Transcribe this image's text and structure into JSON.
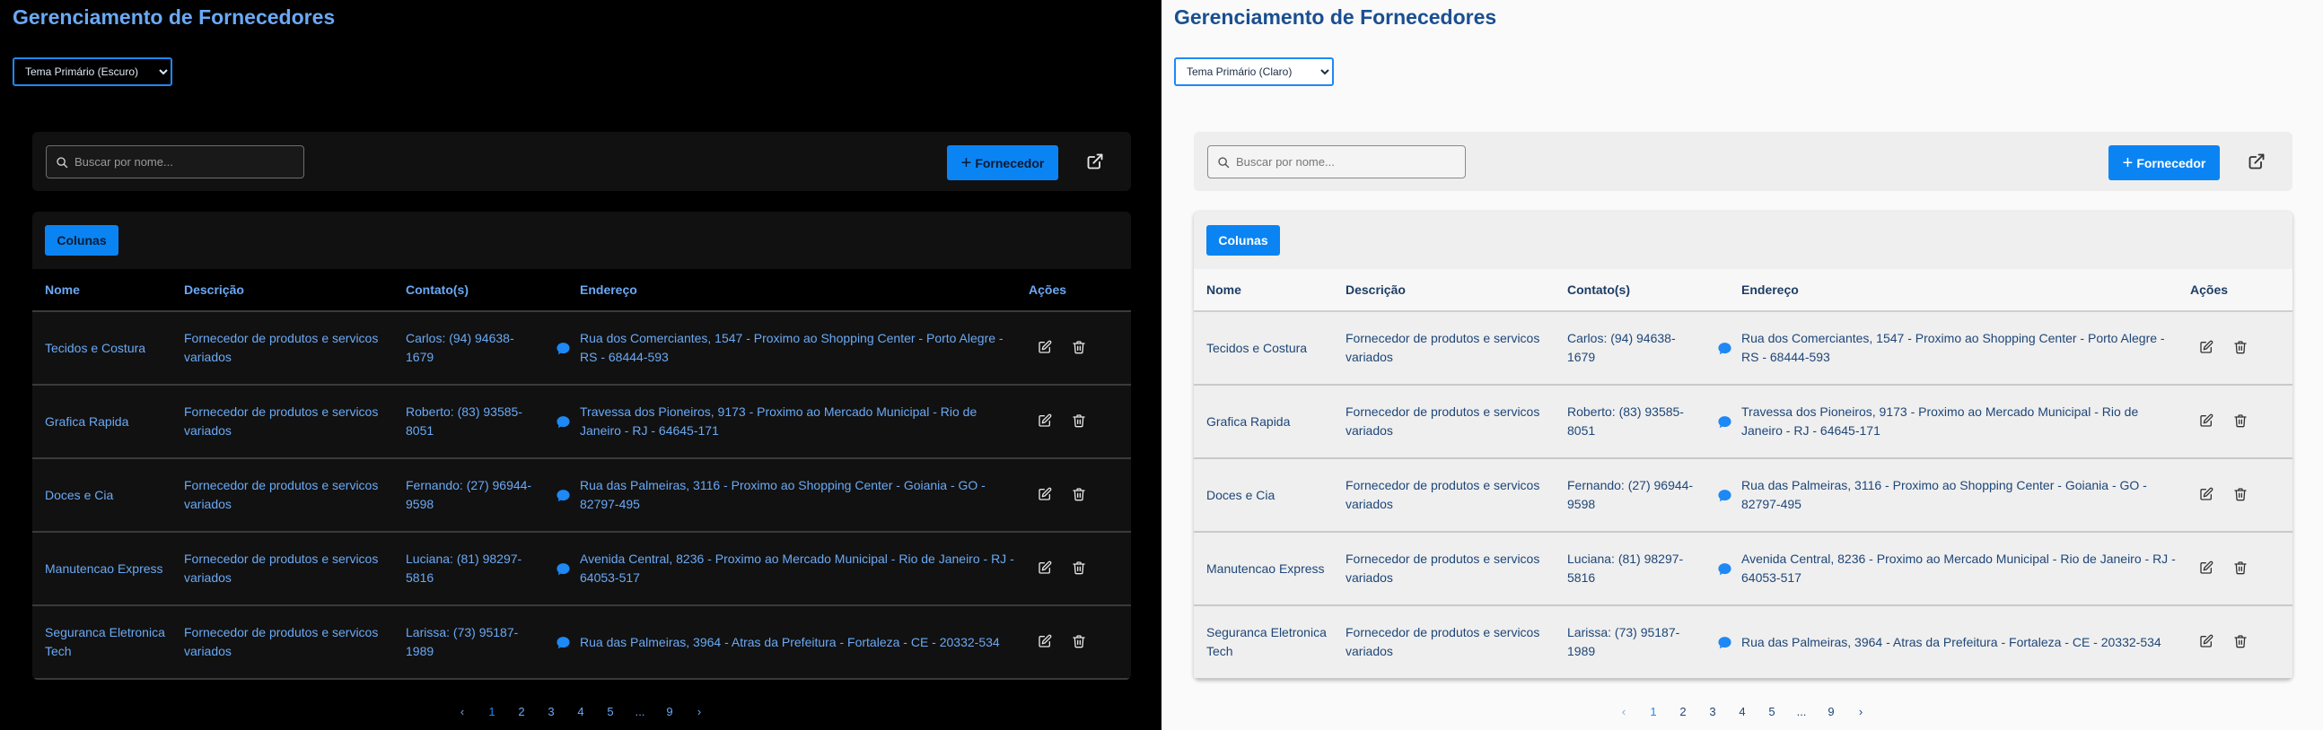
{
  "title": "Gerenciamento de Fornecedores",
  "themes": {
    "dark_label": "Tema Primário (Escuro)",
    "light_label": "Tema Primário (Claro)"
  },
  "search": {
    "placeholder": "Buscar por nome..."
  },
  "toolbar": {
    "add_label": "Fornecedor",
    "columns_label": "Colunas"
  },
  "table": {
    "headers": {
      "name": "Nome",
      "description": "Descrição",
      "contacts": "Contato(s)",
      "address": "Endereço",
      "actions": "Ações"
    },
    "rows": [
      {
        "name": "Tecidos e Costura",
        "description": "Fornecedor de produtos e servicos variados",
        "contact": "Carlos: (94) 94638-1679",
        "address": "Rua dos Comerciantes, 1547 - Proximo ao Shopping Center - Porto Alegre - RS - 68444-593"
      },
      {
        "name": "Grafica Rapida",
        "description": "Fornecedor de produtos e servicos variados",
        "contact": "Roberto: (83) 93585-8051",
        "address": "Travessa dos Pioneiros, 9173 - Proximo ao Mercado Municipal - Rio de Janeiro - RJ - 64645-171"
      },
      {
        "name": "Doces e Cia",
        "description": "Fornecedor de produtos e servicos variados",
        "contact": "Fernando: (27) 96944-9598",
        "address": "Rua das Palmeiras, 3116 - Proximo ao Shopping Center - Goiania - GO - 82797-495"
      },
      {
        "name": "Manutencao Express",
        "description": "Fornecedor de produtos e servicos variados",
        "contact": "Luciana: (81) 98297-5816",
        "address": "Avenida Central, 8236 - Proximo ao Mercado Municipal - Rio de Janeiro - RJ - 64053-517"
      },
      {
        "name": "Seguranca Eletronica Tech",
        "description": "Fornecedor de produtos e servicos variados",
        "contact": "Larissa: (73) 95187-1989",
        "address": "Rua das Palmeiras, 3964 - Atras da Prefeitura - Fortaleza - CE - 20332-534"
      }
    ]
  },
  "pagination": {
    "prev": "‹",
    "pages": [
      "1",
      "2",
      "3",
      "4",
      "5",
      "...",
      "9"
    ],
    "next": "›",
    "current": "1"
  },
  "icons": {
    "search": "search-icon",
    "add": "plus-icon",
    "export": "external-link-icon",
    "contact": "chat-bubble-icon",
    "edit": "edit-icon",
    "delete": "trash-icon"
  },
  "colors": {
    "accent": "#0b84f3",
    "dark_text": "#6aa9f5",
    "light_text": "#1e4678"
  }
}
